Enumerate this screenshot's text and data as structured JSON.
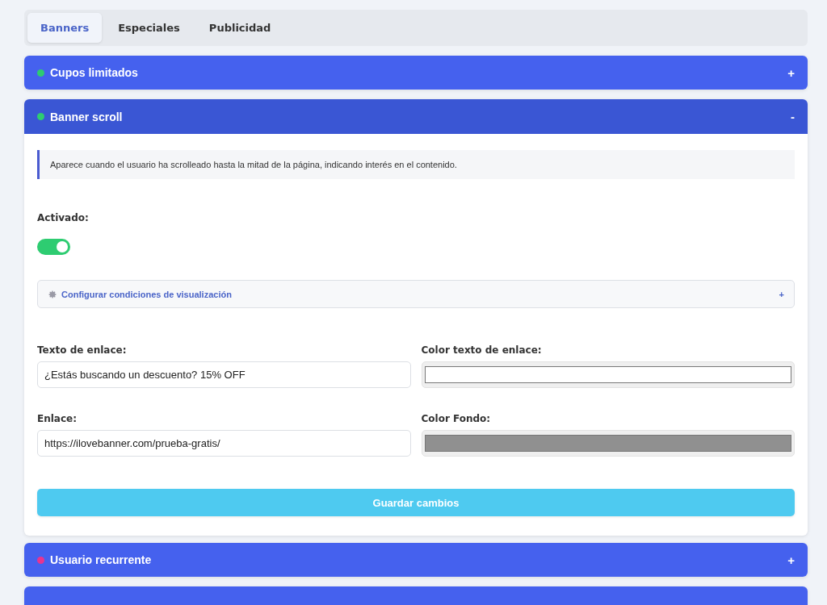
{
  "tabs": [
    {
      "label": "Banners",
      "selected": true
    },
    {
      "label": "Especiales",
      "selected": false
    },
    {
      "label": "Publicidad",
      "selected": false
    }
  ],
  "panels": [
    {
      "title": "Cupos limitados",
      "color": "#2ecc71",
      "expanded": false,
      "toggle": "+"
    },
    {
      "title": "Banner scroll",
      "color": "#2ecc71",
      "expanded": true,
      "toggle": "-",
      "body": {
        "info": "Aparece cuando el usuario ha scrolleado hasta la mitad de la página, indicando interés en el contenido.",
        "switch": {
          "label": "Activado:",
          "on": true
        },
        "conditions": {
          "label": "Configurar condiciones de visualización",
          "toggle": "+"
        },
        "fields": [
          {
            "kind": "text",
            "label": "Texto de enlace:",
            "value": "¿Estás buscando un descuento? 15% OFF"
          },
          {
            "kind": "color",
            "label": "Color texto de enlace:",
            "color": "#ffffff"
          },
          {
            "kind": "text",
            "label": "Enlace:",
            "value": "https://ilovebanner.com/prueba-gratis/"
          },
          {
            "kind": "color",
            "label": "Color Fondo:",
            "color": "#909090"
          }
        ],
        "save": "Guardar cambios"
      }
    },
    {
      "title": "Usuario recurrente",
      "color": "#e8348f",
      "expanded": false,
      "toggle": "+"
    },
    {
      "expanded": false
    }
  ]
}
